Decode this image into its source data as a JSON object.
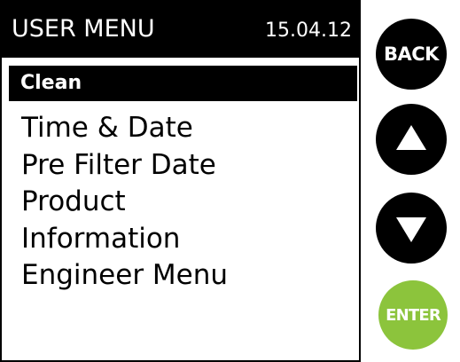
{
  "header": {
    "title": "USER MENU",
    "date": "15.04.12"
  },
  "menu": {
    "selected": "Clean",
    "items": [
      "Time & Date",
      "Pre Filter Date",
      "Product",
      "Information",
      "Engineer Menu"
    ]
  },
  "buttons": {
    "back": {
      "label": "BACK",
      "icon": "back-button",
      "color": "#000000"
    },
    "up": {
      "icon": "arrow-up-icon",
      "color": "#000000"
    },
    "down": {
      "icon": "arrow-down-icon",
      "color": "#000000"
    },
    "enter": {
      "label": "ENTER",
      "icon": "enter-button",
      "color": "#8cc43c"
    }
  },
  "colors": {
    "background": "#ffffff",
    "foreground": "#000000",
    "enter_green": "#8cc43c"
  }
}
